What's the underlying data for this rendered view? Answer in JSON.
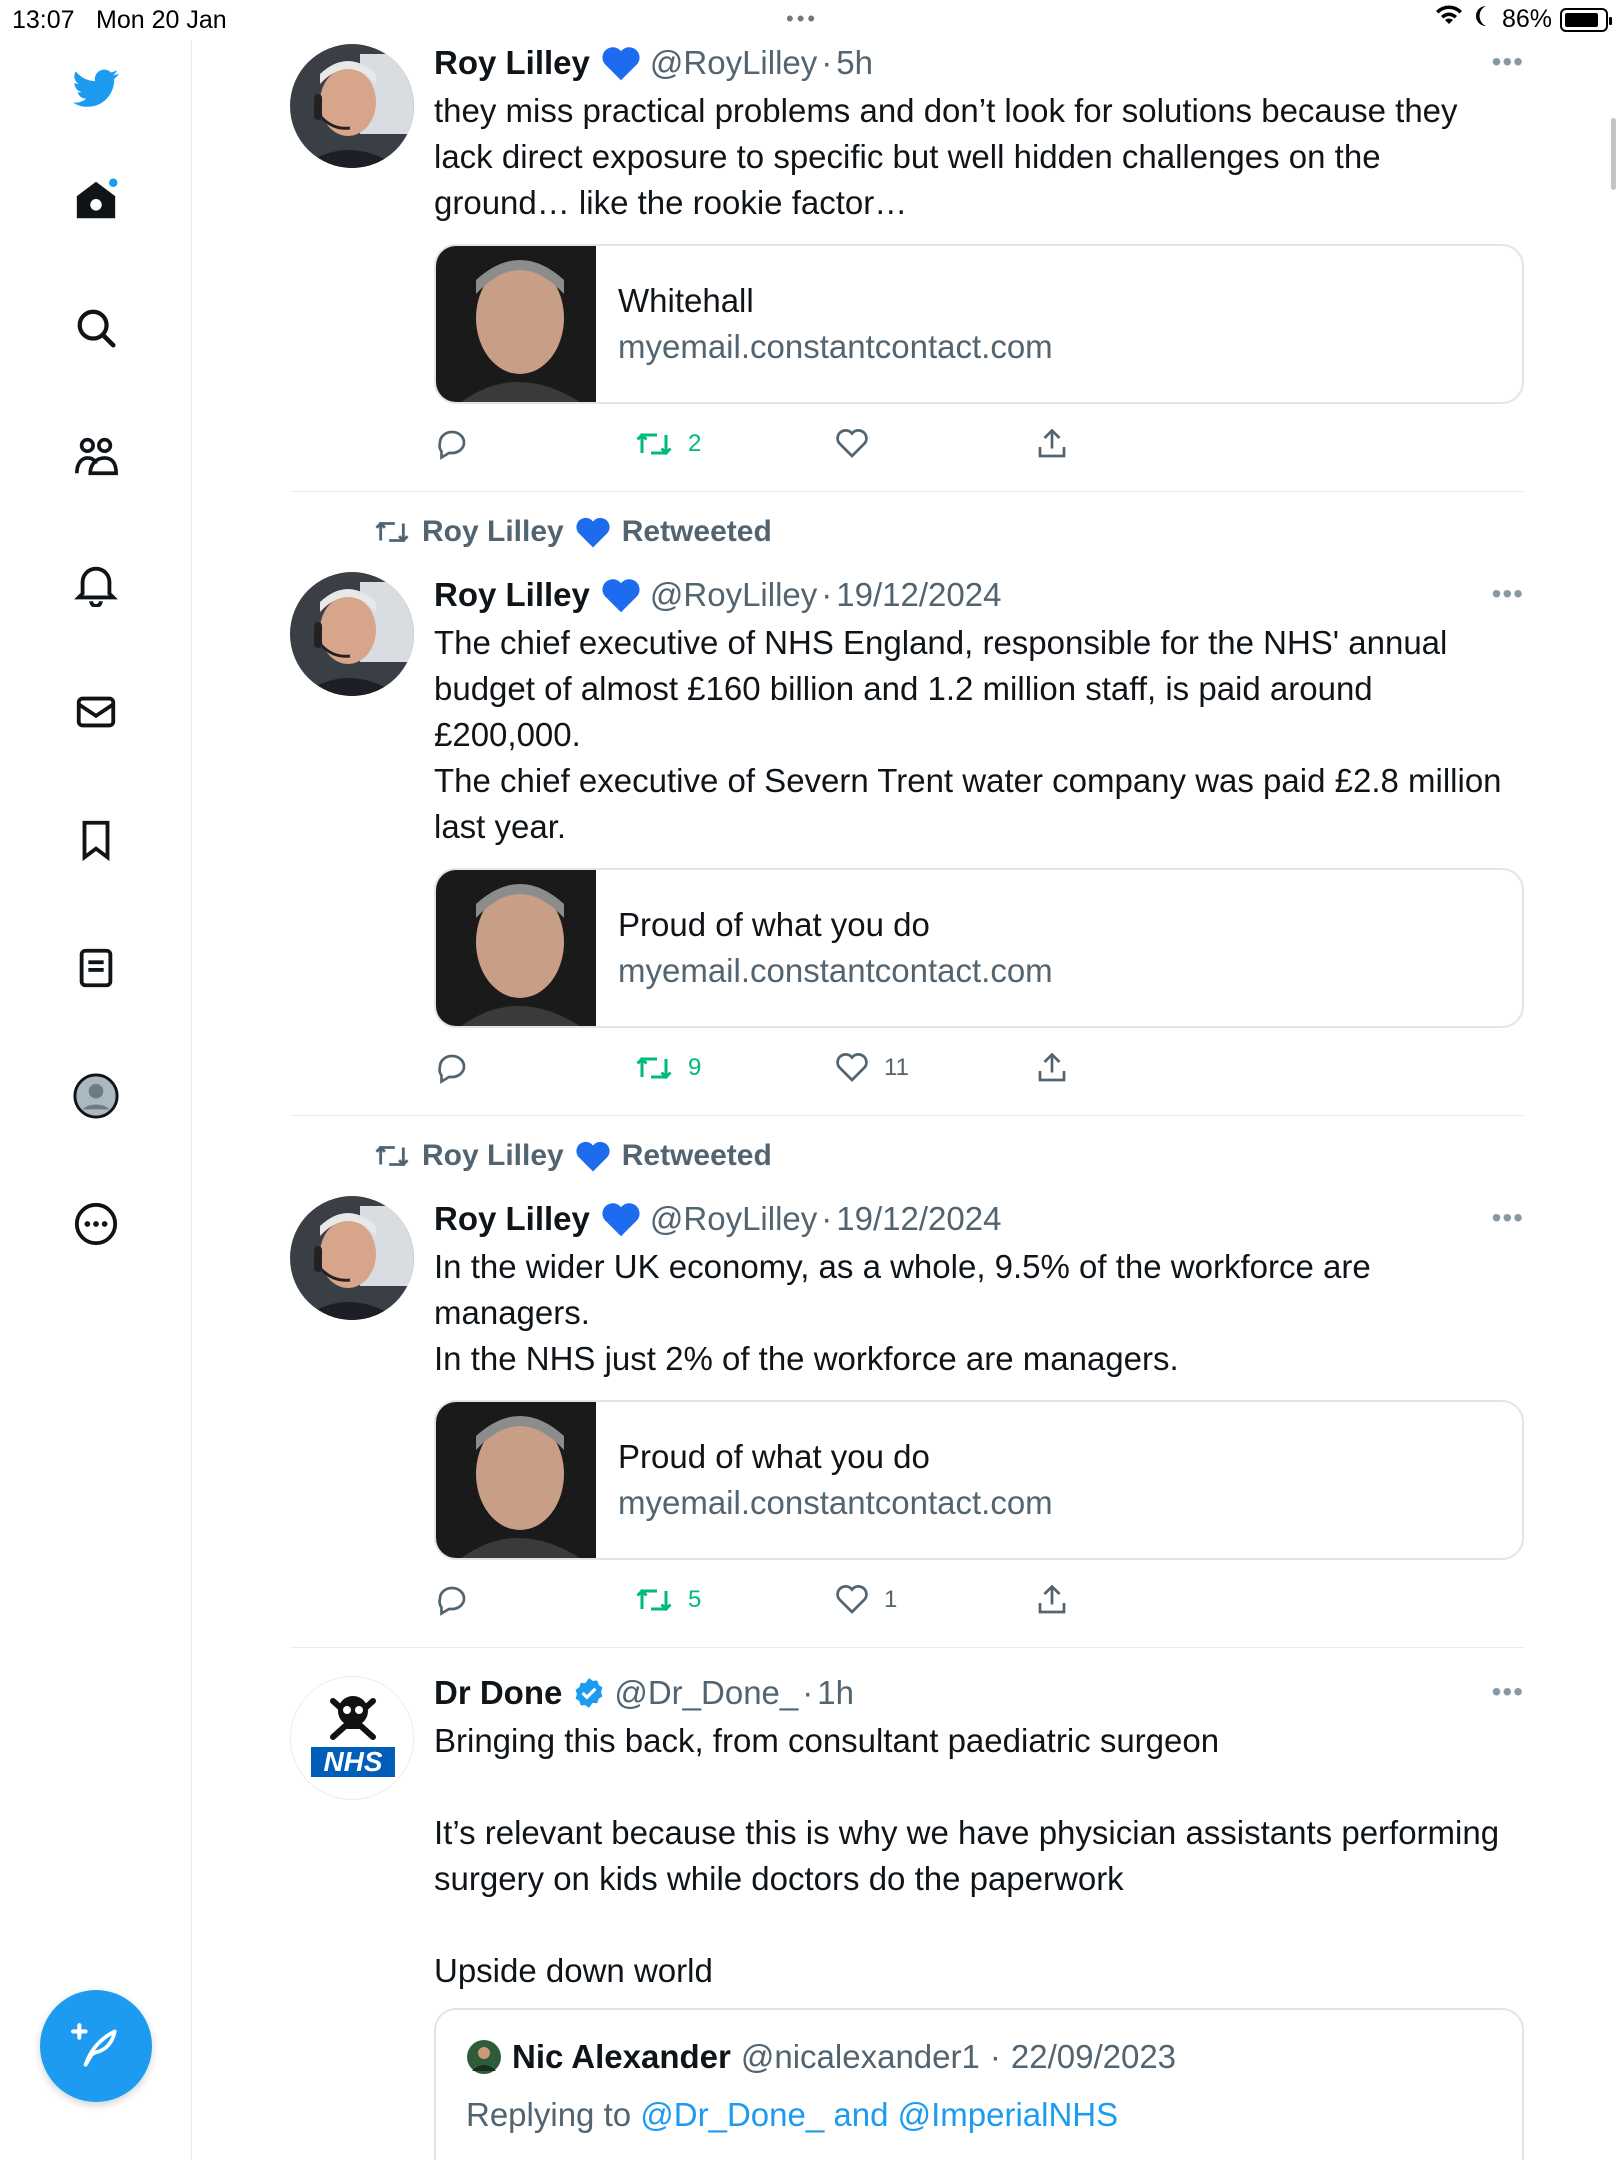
{
  "status_bar": {
    "time": "13:07",
    "date": "Mon 20 Jan",
    "battery": "86%",
    "battery_level": 0.86
  },
  "sidebar": {
    "items": [
      "twitter-logo",
      "home",
      "search",
      "communities",
      "notifications",
      "messages",
      "bookmarks",
      "lists",
      "profile",
      "more"
    ],
    "compose_label": "Compose"
  },
  "colors": {
    "accent": "#1d9bf0",
    "retweet": "#00ba7c",
    "muted": "#536471",
    "border": "#e6ecf0"
  },
  "tweets": [
    {
      "retweeted_by": null,
      "name": "Roy Lilley",
      "handle": "@RoyLilley",
      "sep": "·",
      "time": "5h",
      "text": "they miss practical problems and don’t look for solutions because they lack direct exposure to specific but well hidden challenges on the ground… like the rookie factor…",
      "card": {
        "title": "Whitehall",
        "url": "myemail.constantcontact.com"
      },
      "counts": {
        "reply": "",
        "retweet": "2",
        "like": ""
      }
    },
    {
      "retweeted_by": "Roy Lilley",
      "retweeted_label": "Retweeted",
      "name": "Roy Lilley",
      "handle": "@RoyLilley",
      "sep": "·",
      "time": "19/12/2024",
      "text": "The chief executive of NHS England, responsible for the NHS' annual budget of almost £160 billion and 1.2 million staff, is paid around £200,000.\nThe chief executive of Severn Trent water company was paid £2.8 million last year.",
      "card": {
        "title": "Proud of what you do",
        "url": "myemail.constantcontact.com"
      },
      "counts": {
        "reply": "",
        "retweet": "9",
        "like": "11"
      }
    },
    {
      "retweeted_by": "Roy Lilley",
      "retweeted_label": "Retweeted",
      "name": "Roy Lilley",
      "handle": "@RoyLilley",
      "sep": "·",
      "time": "19/12/2024",
      "text": "In the wider UK economy, as a whole, 9.5% of the workforce are managers.\nIn the NHS just 2% of the workforce are managers.",
      "card": {
        "title": "Proud of what you do",
        "url": "myemail.constantcontact.com"
      },
      "counts": {
        "reply": "",
        "retweet": "5",
        "like": "1"
      }
    },
    {
      "retweeted_by": null,
      "name": "Dr Done",
      "handle": "@Dr_Done_",
      "sep": "·",
      "time": "1h",
      "text": "Bringing this back, from consultant paediatric surgeon\n\nIt’s relevant because this is why we have physician assistants performing surgery on kids while doctors do the paperwork\n\nUpside down world",
      "avatar_logo_text": "NHS",
      "quote": {
        "name": "Nic Alexander",
        "handle": "@nicalexander1",
        "sep": "·",
        "date": "22/09/2023",
        "replying_to_label": "Replying to",
        "mention1": "@Dr_Done_",
        "and": "and",
        "mention2": "@ImperialNHS"
      }
    }
  ]
}
